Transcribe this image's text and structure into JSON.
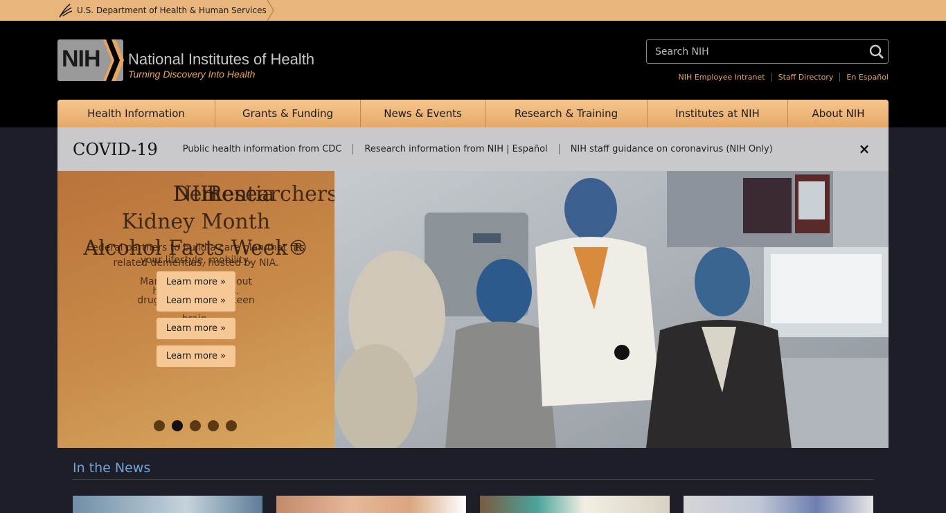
{
  "hhs": {
    "label": "U.S. Department of Health & Human Services"
  },
  "header": {
    "logo_abbr": "NIH",
    "logo_title": "National Institutes of Health",
    "logo_tagline": "Turning Discovery Into Health",
    "search_placeholder": "Search NIH",
    "util_links": [
      "NIH Employee Intranet",
      "Staff Directory",
      "En Español"
    ]
  },
  "nav": {
    "items": [
      {
        "label": "Health Information"
      },
      {
        "label": "Grants & Funding"
      },
      {
        "label": "News & Events"
      },
      {
        "label": "Research & Training"
      },
      {
        "label": "Institutes at NIH"
      },
      {
        "label": "About NIH"
      }
    ]
  },
  "covid": {
    "title": "COVID-19",
    "links": [
      "Public health information from CDC",
      "Research information from NIH | Español",
      "NIH staff guidance on coronavirus (NIH Only)"
    ],
    "close": "×"
  },
  "carousel": {
    "slide_titles": [
      "NIH",
      "Dementia",
      "Kidney Month",
      "Alcohol Facts Week®",
      "Researchers"
    ],
    "slide_descs": [
      "Federal partners to build a care plan that fits your lifestyle, mobility,",
      "related dementias, hosted by NIA.",
      "March 21-2 ence about",
      "health st y needs.",
      "drugs, alco eloping teen",
      "brain."
    ],
    "learn_more": [
      "Learn more »",
      "Learn more »",
      "Learn more »",
      "Learn more »"
    ],
    "active_dot": 1,
    "dot_count": 5
  },
  "news": {
    "title": "In the News"
  },
  "colors": {
    "accent": "#e8a55c",
    "nav": "#f0b87a",
    "news_title": "#6fa3d6"
  }
}
